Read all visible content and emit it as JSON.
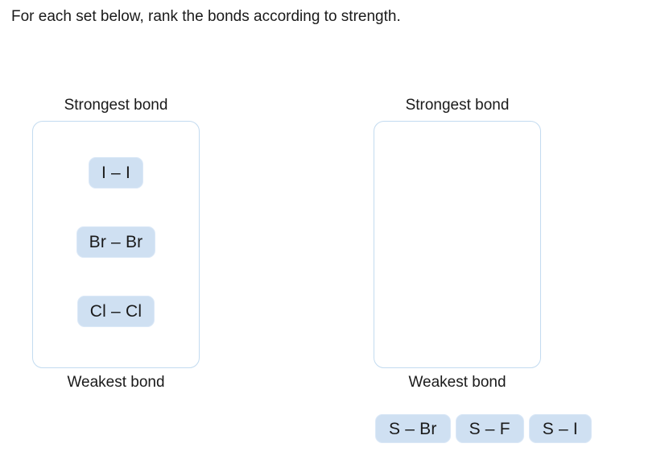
{
  "prompt": "For each set below, rank the bonds according to strength.",
  "columns": [
    {
      "top_label": "Strongest bond",
      "bottom_label": "Weakest bond",
      "tiles": [
        {
          "label": "I – I"
        },
        {
          "label": "Br –  Br"
        },
        {
          "label": "Cl –  Cl"
        }
      ]
    },
    {
      "top_label": "Strongest bond",
      "bottom_label": "Weakest bond",
      "tiles": []
    }
  ],
  "tile_bank": [
    {
      "label": "S – Br"
    },
    {
      "label": "S – F"
    },
    {
      "label": "S – I"
    }
  ],
  "colors": {
    "tile_fill": "#cfe0f2",
    "tile_border": "#dbe8f7",
    "zone_border": "#c3dbf0",
    "background": "#ffffff",
    "text": "#1a1a1a"
  }
}
